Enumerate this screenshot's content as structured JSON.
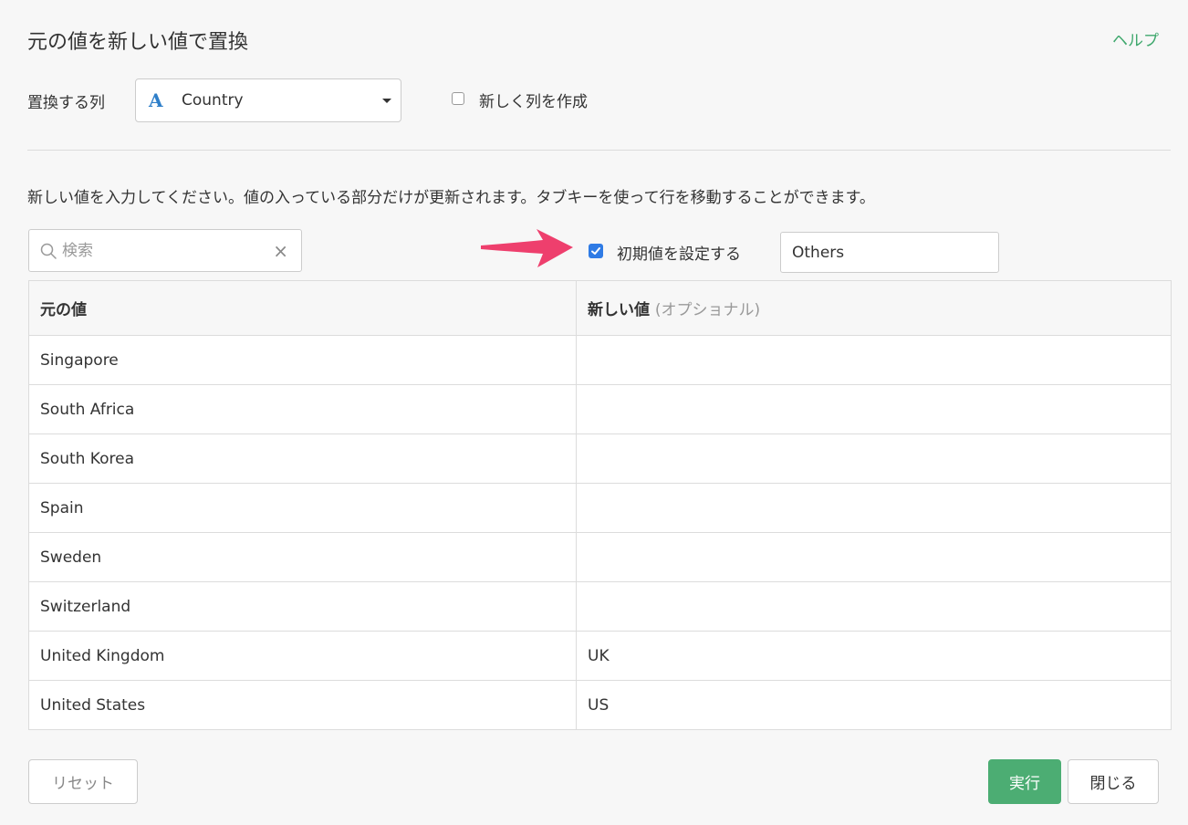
{
  "header": {
    "title": "元の値を新しい値で置換",
    "help_label": "ヘルプ"
  },
  "column_select": {
    "label": "置換する列",
    "type_icon": "A",
    "value": "Country"
  },
  "new_column": {
    "label": "新しく列を作成",
    "checked": false
  },
  "instruction": "新しい値を入力してください。値の入っている部分だけが更新されます。タブキーを使って行を移動することができます。",
  "search": {
    "placeholder": "検索",
    "value": ""
  },
  "default_value": {
    "label": "初期値を設定する",
    "checked": true,
    "value": "Others"
  },
  "table": {
    "headers": {
      "original": "元の値",
      "new": "新しい値",
      "new_note": "(オプショナル)"
    },
    "rows": [
      {
        "original": "Singapore",
        "new": ""
      },
      {
        "original": "South Africa",
        "new": ""
      },
      {
        "original": "South Korea",
        "new": ""
      },
      {
        "original": "Spain",
        "new": ""
      },
      {
        "original": "Sweden",
        "new": ""
      },
      {
        "original": "Switzerland",
        "new": ""
      },
      {
        "original": "United Kingdom",
        "new": "UK"
      },
      {
        "original": "United States",
        "new": "US"
      }
    ]
  },
  "footer": {
    "reset_label": "リセット",
    "run_label": "実行",
    "close_label": "閉じる"
  },
  "colors": {
    "accent_green": "#4cad73",
    "link_green": "#3fa86d",
    "checkbox_blue": "#2f7be5",
    "arrow_pink": "#ee3f6d",
    "type_icon_blue": "#2f7fc9"
  },
  "icons": {
    "search": "search-icon",
    "clear": "close-icon",
    "dropdown": "caret-down-icon",
    "type": "string-type-icon",
    "annotation": "arrow-annotation-icon"
  }
}
